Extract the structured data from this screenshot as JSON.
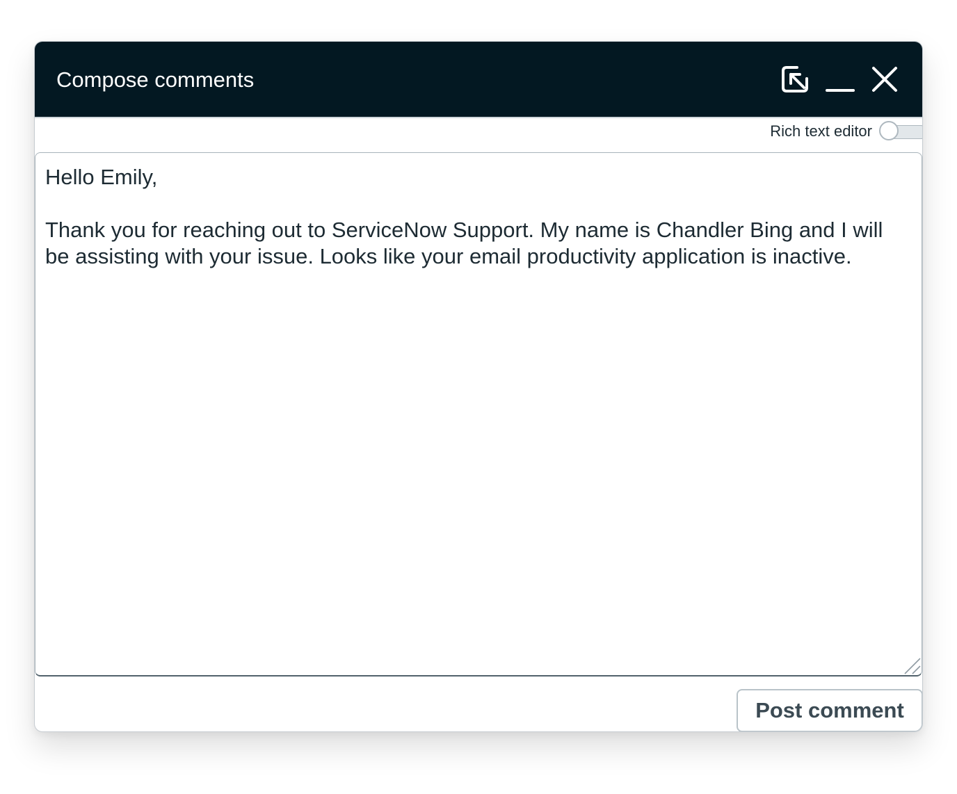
{
  "dialog": {
    "title": "Compose comments",
    "icons": {
      "popout": "popout-icon",
      "minimize": "minimize-icon",
      "close": "close-icon"
    }
  },
  "rich_text_editor": {
    "label": "Rich text editor",
    "enabled": false
  },
  "comment": {
    "value": "Hello Emily,\n\nThank you for reaching out to ServiceNow Support. My name is Chandler Bing and I will be assisting with your issue. Looks like your email productivity application is inactive."
  },
  "footer": {
    "post_label": "Post comment"
  },
  "colors": {
    "header_bg": "#031822",
    "text": "#1d2b33",
    "border": "#a8b3ba"
  }
}
